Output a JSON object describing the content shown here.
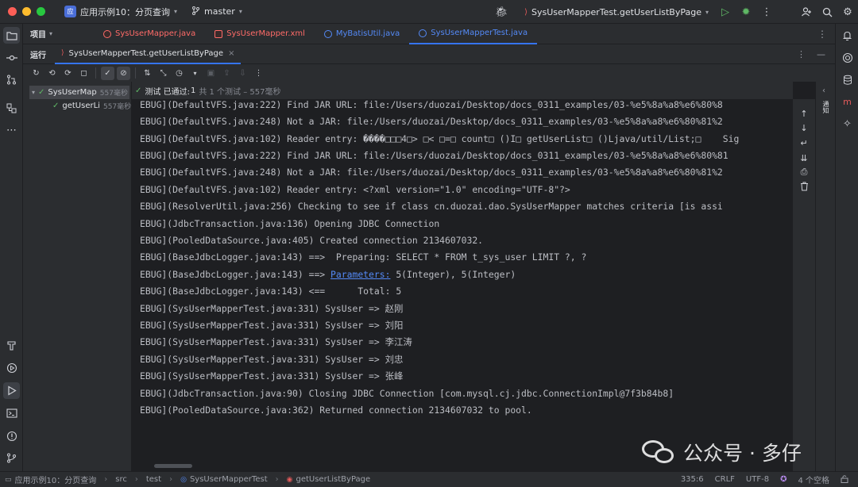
{
  "titlebar": {
    "project_badge": "应",
    "project_name": "应用示例10：分页查询",
    "branch": "master",
    "run_config": "SysUserMapperTest.getUserListByPage"
  },
  "project_panel": {
    "label": "项目"
  },
  "editor_tabs": [
    {
      "label": "SysUserMapper.java",
      "color": "#ff6b68",
      "icon": "interface-icon"
    },
    {
      "label": "SysUserMapper.xml",
      "color": "#ff6b68",
      "icon": "xml-icon"
    },
    {
      "label": "MyBatisUtil.java",
      "color": "#548af7",
      "icon": "class-icon"
    },
    {
      "label": "SysUserMapperTest.java",
      "color": "#548af7",
      "icon": "test-class-icon"
    }
  ],
  "run_window": {
    "label": "运行",
    "tab_label": "SysUserMapperTest.getUserListByPage"
  },
  "tree": {
    "root": {
      "label": "SysUserMap",
      "duration": "557毫秒"
    },
    "child": {
      "label": "getUserLi",
      "duration": "557毫秒"
    }
  },
  "test_status": {
    "label": "测试 已通过:",
    "count": "1",
    "summary": "共 1 个测试 – 557毫秒"
  },
  "console": {
    "lines": [
      {
        "text": "EBUG](DefaultVFS.java:222) Find JAR URL: file:/Users/duozai/Desktop/docs_0311_examples/03-%e5%8a%a8%e6%80%8"
      },
      {
        "text": "EBUG](DefaultVFS.java:248) Not a JAR: file:/Users/duozai/Desktop/docs_0311_examples/03-%e5%8a%a8%e6%80%81%2"
      },
      {
        "text": "EBUG](DefaultVFS.java:102) Reader entry: ����□□□4□> □< □=□ count□ ()I□ getUserList□ ()Ljava/util/List;□    Sig"
      },
      {
        "text": "EBUG](DefaultVFS.java:222) Find JAR URL: file:/Users/duozai/Desktop/docs_0311_examples/03-%e5%8a%a8%e6%80%81"
      },
      {
        "text": "EBUG](DefaultVFS.java:248) Not a JAR: file:/Users/duozai/Desktop/docs_0311_examples/03-%e5%8a%a8%e6%80%81%2"
      },
      {
        "text": "EBUG](DefaultVFS.java:102) Reader entry: <?xml version=\"1.0\" encoding=\"UTF-8\"?>"
      },
      {
        "text": "EBUG](ResolverUtil.java:256) Checking to see if class cn.duozai.dao.SysUserMapper matches criteria [is assi"
      },
      {
        "text": "EBUG](JdbcTransaction.java:136) Opening JDBC Connection"
      },
      {
        "text": "EBUG](PooledDataSource.java:405) Created connection 2134607032."
      },
      {
        "text": "EBUG](BaseJdbcLogger.java:143) ==>  Preparing: SELECT * FROM t_sys_user LIMIT ?, ?"
      },
      {
        "text": "EBUG](BaseJdbcLogger.java:143) ==> ",
        "link": "Parameters:",
        "after": " 5(Integer), 5(Integer)"
      },
      {
        "text": "EBUG](BaseJdbcLogger.java:143) <==      Total: 5"
      },
      {
        "text": "EBUG](SysUserMapperTest.java:331) SysUser => 赵刚"
      },
      {
        "text": "EBUG](SysUserMapperTest.java:331) SysUser => 刘阳"
      },
      {
        "text": "EBUG](SysUserMapperTest.java:331) SysUser => 李江涛"
      },
      {
        "text": "EBUG](SysUserMapperTest.java:331) SysUser => 刘忠"
      },
      {
        "text": "EBUG](SysUserMapperTest.java:331) SysUser => 张峰"
      },
      {
        "text": "EBUG](JdbcTransaction.java:90) Closing JDBC Connection [com.mysql.cj.jdbc.ConnectionImpl@7f3b84b8]"
      },
      {
        "text": "EBUG](PooledDataSource.java:362) Returned connection 2134607032 to pool."
      }
    ]
  },
  "right_vertical_label": "通知",
  "watermark": {
    "text": "公众号 · 多仔"
  },
  "statusbar": {
    "breadcrumbs": [
      "应用示例10：分页查询",
      "src",
      "test",
      "SysUserMapperTest",
      "getUserListByPage"
    ],
    "position": "335:6",
    "line_ending": "CRLF",
    "encoding": "UTF-8",
    "indent": "4 个空格"
  }
}
